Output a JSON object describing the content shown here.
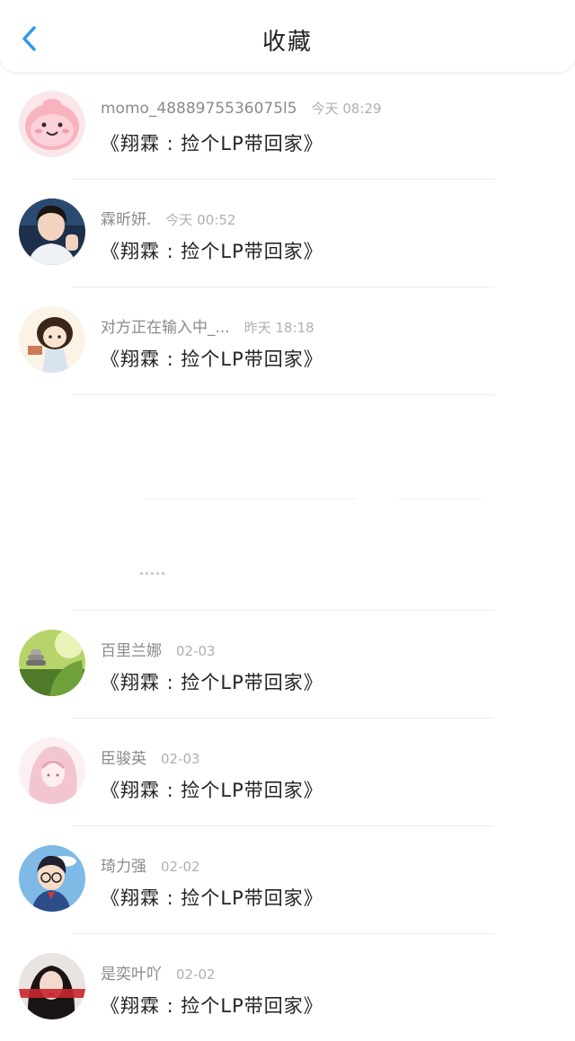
{
  "header": {
    "title": "收藏",
    "back_icon": "chevron-left-icon",
    "accent": "#2d9ae5"
  },
  "items": [
    {
      "user": "momo_4888975536075l5",
      "time": "今天 08:29",
      "title": "《翔霖 : 捡个LP带回家》",
      "avatar": "pink-cartoon-avatar"
    },
    {
      "user": "霖昕妍.",
      "time": "今天 00:52",
      "title": "《翔霖 : 捡个LP带回家》",
      "avatar": "boy-photo-avatar"
    },
    {
      "user": "对方正在输入中_...",
      "time": "昨天 18:18",
      "title": "《翔霖 : 捡个LP带回家》",
      "avatar": "anime-girl-avatar"
    },
    {
      "user": "百里兰娜",
      "time": "02-03",
      "title": "《翔霖 : 捡个LP带回家》",
      "avatar": "nature-scene-avatar"
    },
    {
      "user": "臣骏英",
      "time": "02-03",
      "title": "《翔霖 : 捡个LP带回家》",
      "avatar": "pink-anime-avatar"
    },
    {
      "user": "琦力强",
      "time": "02-02",
      "title": "《翔霖 : 捡个LP带回家》",
      "avatar": "detective-cartoon-avatar"
    },
    {
      "user": "是奕叶吖",
      "time": "02-02",
      "title": "《翔霖 : 捡个LP带回家》",
      "avatar": "girl-photo-avatar"
    }
  ]
}
